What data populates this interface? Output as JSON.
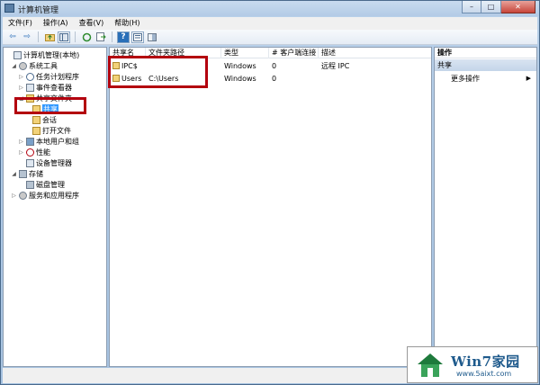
{
  "window": {
    "title": "计算机管理",
    "caption": {
      "minimize": "–",
      "maximize": "□",
      "close": "✕"
    }
  },
  "menu": [
    "文件(F)",
    "操作(A)",
    "查看(V)",
    "帮助(H)"
  ],
  "toolbar": {
    "icons": [
      "back-arrow-icon",
      "forward-arrow-icon",
      "up-folder-icon",
      "show-tree-icon",
      "refresh-icon",
      "export-icon",
      "help-icon",
      "properties-icon",
      "pane-icon"
    ],
    "glyphs": {
      "back": "⇦",
      "forward": "⇨",
      "help": "?"
    }
  },
  "tree": [
    {
      "label": "计算机管理(本地)",
      "icon": "computer-icon",
      "twisty": ""
    },
    {
      "label": "系统工具",
      "icon": "tools-icon",
      "twisty": "◢"
    },
    {
      "label": "任务计划程序",
      "icon": "clock-icon",
      "twisty": "▷"
    },
    {
      "label": "事件查看器",
      "icon": "event-viewer-icon",
      "twisty": "▷"
    },
    {
      "label": "共享文件夹",
      "icon": "shared-folder-icon",
      "twisty": "◢"
    },
    {
      "label": "共享",
      "icon": "share-icon",
      "twisty": "",
      "selected": true
    },
    {
      "label": "会话",
      "icon": "session-icon",
      "twisty": ""
    },
    {
      "label": "打开文件",
      "icon": "open-files-icon",
      "twisty": ""
    },
    {
      "label": "本地用户和组",
      "icon": "users-icon",
      "twisty": "▷"
    },
    {
      "label": "性能",
      "icon": "performance-icon",
      "twisty": "▷"
    },
    {
      "label": "设备管理器",
      "icon": "device-manager-icon",
      "twisty": ""
    },
    {
      "label": "存储",
      "icon": "storage-icon",
      "twisty": "◢"
    },
    {
      "label": "磁盘管理",
      "icon": "disk-icon",
      "twisty": ""
    },
    {
      "label": "服务和应用程序",
      "icon": "services-icon",
      "twisty": "▷"
    }
  ],
  "list": {
    "columns": [
      "共享名",
      "文件夹路径",
      "类型",
      "# 客户端连接",
      "描述"
    ],
    "rows": [
      {
        "name": "IPC$",
        "path": "",
        "type": "Windows",
        "clients": "0",
        "desc": "远程 IPC"
      },
      {
        "name": "Users",
        "path": "C:\\Users",
        "type": "Windows",
        "clients": "0",
        "desc": ""
      }
    ]
  },
  "actions": {
    "title": "操作",
    "group": "共享",
    "item": "更多操作",
    "arrow": "▶"
  },
  "watermark": {
    "brand": "Win7家园",
    "url": "www.5aixt.com"
  },
  "colors": {
    "highlight": "#b3000e",
    "selection": "#3399ff"
  }
}
